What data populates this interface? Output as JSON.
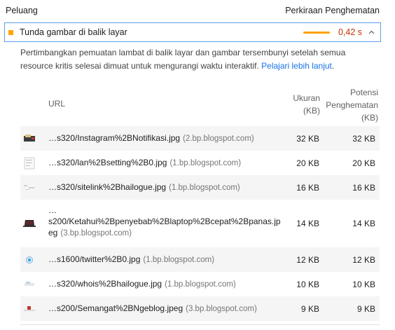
{
  "header": {
    "left": "Peluang",
    "right": "Perkiraan Penghematan"
  },
  "audit": {
    "title": "Tunda gambar di balik layar",
    "value": "0,42 s",
    "status_color": "#ffa400"
  },
  "description": {
    "text": "Pertimbangkan pemuatan lambat di balik layar dan gambar tersembunyi setelah semua resource kritis selesai dimuat untuk mengurangi waktu interaktif. ",
    "link": "Pelajari lebih lanjut",
    "suffix": "."
  },
  "table": {
    "col_url": "URL",
    "col_size_1": "Ukuran",
    "col_size_2": "(KB)",
    "col_saving_1": "Potensi",
    "col_saving_2": "Penghematan",
    "col_saving_3": "(KB)",
    "rows": [
      {
        "path": "…s320/Instagram%2BNotifikasi.jpg",
        "host": "(2.bp.blogspot.com)",
        "size": "32 KB",
        "saving": "32 KB",
        "thumb": "instagram-thumbnail"
      },
      {
        "path": "…s320/lan%2Bsetting%2B0.jpg",
        "host": "(1.bp.blogspot.com)",
        "size": "20 KB",
        "saving": "20 KB",
        "thumb": "lan-setting-thumbnail"
      },
      {
        "path": "…s320/sitelink%2Bhailogue.jpg",
        "host": "(1.bp.blogspot.com)",
        "size": "16 KB",
        "saving": "16 KB",
        "thumb": "sitelink-thumbnail"
      },
      {
        "path_1": "…",
        "path_2": "s200/Ketahui%2Bpenyebab%2Blaptop%2Bcepat%2Bpanas.jp",
        "path_3": "eg",
        "host": "(3.bp.blogspot.com)",
        "size": "14 KB",
        "saving": "14 KB",
        "thumb": "laptop-thumbnail"
      },
      {
        "path": "…s1600/twitter%2B0.jpg",
        "host": "(1.bp.blogspot.com)",
        "size": "12 KB",
        "saving": "12 KB",
        "thumb": "twitter-thumbnail"
      },
      {
        "path": "…s320/whois%2Bhailogue.jpg",
        "host": "(1.bp.blogspot.com)",
        "size": "10 KB",
        "saving": "10 KB",
        "thumb": "whois-thumbnail"
      },
      {
        "path": "…s200/Semangat%2BNgeblog.jpeg",
        "host": "(3.bp.blogspot.com)",
        "size": "9 KB",
        "saving": "9 KB",
        "thumb": "semangat-thumbnail"
      }
    ]
  }
}
